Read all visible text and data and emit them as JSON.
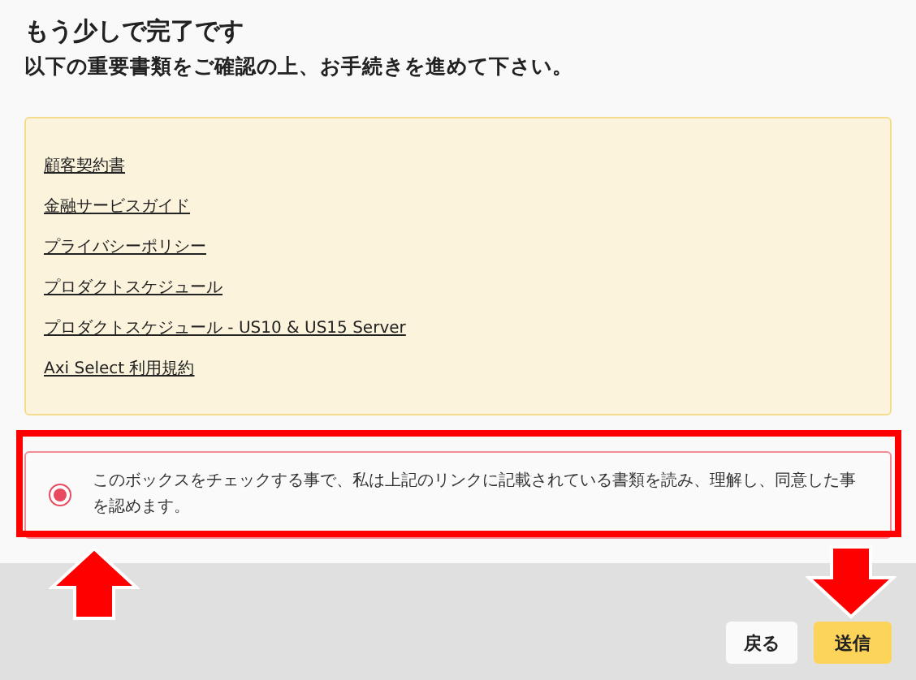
{
  "heading": "もう少しで完了です",
  "subheading": "以下の重要書類をご確認の上、お手続きを進めて下さい。",
  "documents": [
    {
      "label": "顧客契約書"
    },
    {
      "label": "金融サービスガイド"
    },
    {
      "label": "プライバシーポリシー"
    },
    {
      "label": "プロダクトスケジュール"
    },
    {
      "label": "プロダクトスケジュール - US10 & US15 Server"
    },
    {
      "label": "Axi Select 利用規約"
    }
  ],
  "agreement": {
    "text": "このボックスをチェックする事で、私は上記のリンクに記載されている書類を読み、理解し、同意した事を認めます。",
    "checked": true
  },
  "buttons": [
    {
      "label": "戻る",
      "kind": "secondary"
    },
    {
      "label": "送信",
      "kind": "primary"
    }
  ]
}
